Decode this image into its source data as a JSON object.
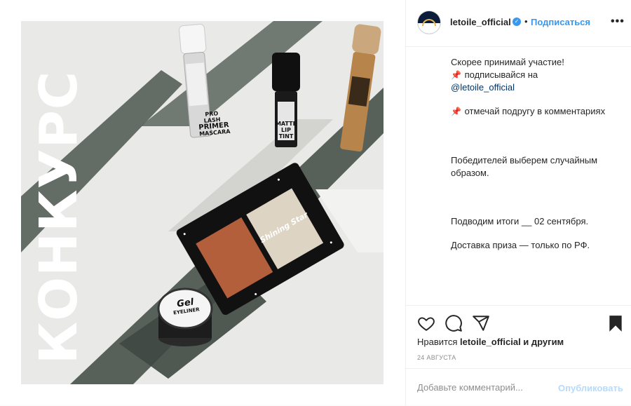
{
  "post": {
    "image": {
      "contest_word": "КОНКУРС",
      "products": {
        "primer": [
          "PRO LASH",
          "PRIMER",
          "MASCARA"
        ],
        "tint": [
          "MATTE",
          "LIP",
          "TINT"
        ],
        "gel": [
          "Gel",
          "EYELINER"
        ],
        "palette": "Shining Star"
      }
    },
    "header": {
      "username": "letoile_official",
      "verified_icon": "✓",
      "separator": "•",
      "follow_label": "Подписаться",
      "more_label": "•••"
    },
    "caption": {
      "line1": "Скорее принимай участие!",
      "pin_icon": "📌",
      "line2_text": " подписывайся на",
      "mention": "@letoile_official",
      "line3_text": " отмечай подругу в комментариях",
      "line4": "Победителей выберем случайным образом.",
      "line5": "Подводим итоги __ 02 сентября.",
      "line6": "Доставка приза — только по РФ."
    },
    "likes": {
      "prefix": "Нравится ",
      "user": "letoile_official",
      "suffix": " и другим"
    },
    "date": "24 августа",
    "comment": {
      "placeholder": "Добавьте комментарий...",
      "publish_label": "Опубликовать"
    },
    "colors": {
      "accent": "#3897f0",
      "publish_disabled": "#b3dbff",
      "muted": "#8e8e8e"
    }
  }
}
